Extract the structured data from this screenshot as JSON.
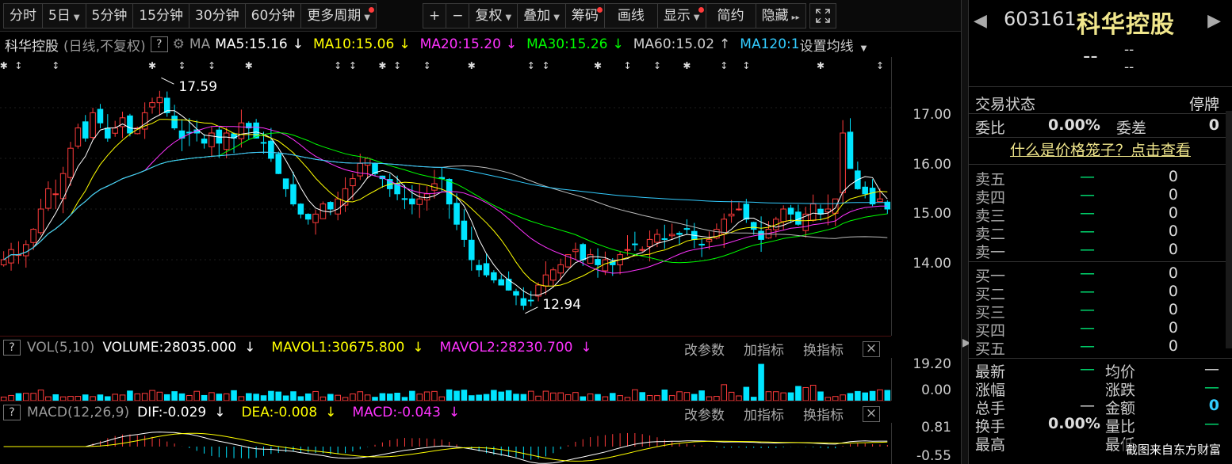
{
  "toolbar": {
    "periods": [
      "分时",
      "5日",
      "5分钟",
      "15分钟",
      "30分钟",
      "60分钟",
      "更多周期"
    ],
    "tools": [
      "+",
      "−",
      "复权",
      "叠加",
      "筹码",
      "画线",
      "显示",
      "简约",
      "隐藏"
    ],
    "expand_icon": "fullscreen-icon"
  },
  "ma_legend": {
    "stock_name": "科华控股",
    "mode": "(日线,不复权)",
    "help": "?",
    "ma_label": "MA",
    "ma5": "MA5:15.16",
    "ma10": "MA10:15.06",
    "ma20": "MA20:15.20",
    "ma30": "MA30:15.26",
    "ma60": "MA60:15.02",
    "ma120": "MA120:1",
    "settings": "设置均线",
    "arrow_down": "↓",
    "arrow_up": "↑"
  },
  "main_chart": {
    "y_ticks": [
      "17.00",
      "16.00",
      "15.00",
      "14.00"
    ],
    "high_annotation": "17.59",
    "low_annotation": "12.94"
  },
  "volume_panel": {
    "help": "?",
    "title": "VOL(5,10)",
    "volume": "VOLUME:28035.000",
    "mavol1": "MAVOL1:30675.800",
    "mavol2": "MAVOL2:28230.700",
    "y_ticks": [
      "19.20",
      "0.00"
    ]
  },
  "macd_panel": {
    "help": "?",
    "title": "MACD(12,26,9)",
    "dif": "DIF:-0.029",
    "dea": "DEA:-0.008",
    "macd": "MACD:-0.043",
    "y_ticks": [
      "0.81",
      "-0.55"
    ]
  },
  "panel_tools": {
    "params": "改参数",
    "add": "加指标",
    "switch": "换指标",
    "close": "×"
  },
  "quote": {
    "code": "603161",
    "name": "科华控股",
    "price": "--",
    "change": "--",
    "change_pct": "--",
    "status_label": "交易状态",
    "status_value": "停牌",
    "ratio_label": "委比",
    "ratio_value": "0.00%",
    "diff_label": "委差",
    "diff_value": "0",
    "cage_link": "什么是价格笼子？点击查看"
  },
  "order_book": {
    "asks": [
      {
        "label": "卖五",
        "price": "—",
        "vol": "0"
      },
      {
        "label": "卖四",
        "price": "—",
        "vol": "0"
      },
      {
        "label": "卖三",
        "price": "—",
        "vol": "0"
      },
      {
        "label": "卖二",
        "price": "—",
        "vol": "0"
      },
      {
        "label": "卖一",
        "price": "—",
        "vol": "0"
      }
    ],
    "bids": [
      {
        "label": "买一",
        "price": "—",
        "vol": "0"
      },
      {
        "label": "买二",
        "price": "—",
        "vol": "0"
      },
      {
        "label": "买三",
        "price": "—",
        "vol": "0"
      },
      {
        "label": "买四",
        "price": "—",
        "vol": "0"
      },
      {
        "label": "买五",
        "price": "—",
        "vol": "0"
      }
    ]
  },
  "stats": {
    "latest": "最新",
    "latest_val": "—",
    "avg": "均价",
    "avg_val": "—",
    "chg_pct": "涨幅",
    "chg_pct_val": "",
    "chg": "涨跌",
    "chg_val": "—",
    "vol": "总手",
    "vol_val": "—",
    "amount": "金额",
    "amount_val": "0",
    "turnover": "换手",
    "turnover_val": "0.00%",
    "vol_ratio": "量比",
    "vol_ratio_val": "—",
    "high": "最高",
    "low": "最低"
  },
  "watermark": "截图来自东方财富",
  "colors": {
    "up": "#ff3b3b",
    "down": "#00e5ff",
    "ma5": "#ffffff",
    "ma10": "#ffff00",
    "ma20": "#ff33ff",
    "ma30": "#00ff00",
    "ma60": "#bbbbbb",
    "ma120": "#33ccff"
  },
  "chart_data": {
    "type": "candlestick",
    "ylim": [
      12.5,
      18.0
    ],
    "n": 120,
    "close": [
      14.0,
      14.2,
      14.1,
      14.3,
      14.6,
      15.0,
      15.4,
      15.3,
      15.7,
      16.2,
      16.6,
      16.4,
      16.9,
      16.7,
      16.4,
      16.6,
      16.8,
      16.5,
      16.6,
      16.9,
      17.1,
      17.2,
      16.9,
      16.6,
      16.4,
      16.5,
      16.5,
      16.3,
      16.5,
      16.3,
      16.5,
      16.4,
      16.7,
      16.6,
      16.4,
      16.3,
      16.0,
      15.7,
      15.4,
      15.1,
      14.9,
      14.8,
      14.9,
      15.1,
      15.0,
      15.2,
      15.4,
      15.6,
      15.9,
      16.0,
      15.7,
      15.6,
      15.4,
      15.3,
      15.2,
      15.1,
      15.2,
      15.3,
      15.5,
      15.6,
      15.1,
      14.7,
      14.4,
      14.0,
      13.8,
      13.7,
      13.6,
      13.5,
      13.4,
      13.3,
      13.1,
      13.2,
      13.5,
      13.7,
      13.8,
      13.9,
      14.1,
      14.2,
      14.0,
      14.1,
      13.9,
      14.0,
      13.9,
      14.1,
      14.2,
      14.3,
      14.2,
      14.4,
      14.5,
      14.4,
      14.5,
      14.5,
      14.6,
      14.4,
      14.3,
      14.4,
      14.6,
      14.8,
      14.9,
      15.0,
      14.8,
      14.6,
      14.4,
      14.6,
      14.8,
      15.0,
      14.9,
      14.7,
      14.9,
      15.1,
      14.9,
      15.0,
      15.2,
      16.5,
      15.8,
      15.4,
      15.3,
      15.1,
      15.2,
      15.0
    ]
  }
}
